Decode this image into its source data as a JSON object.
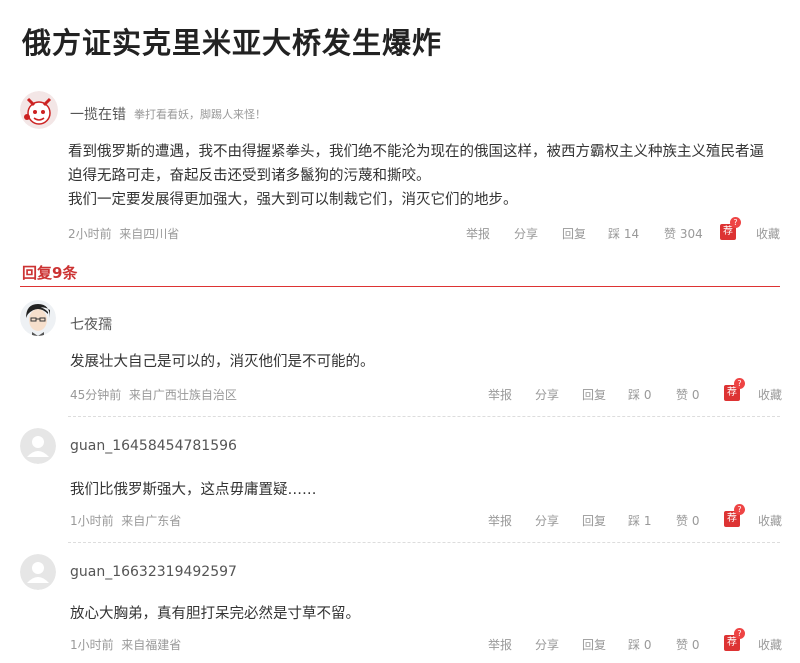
{
  "page": {
    "title": "俄方证实克里米亚大桥发生爆炸"
  },
  "post": {
    "username": "一揽在错",
    "signature": "拳打看看妖，脚踢人来怪！",
    "body_line1": "看到俄罗斯的遭遇，我不由得握紧拳头，我们绝不能沦为现在的俄国这样，被西方霸权主义种族主义殖民者逼",
    "body_line2": "迫得无路可走，奋起反击还受到诸多鬣狗的污蔑和撕咬。",
    "body_line3": "我们一定要发展得更加强大，强大到可以制裁它们，消灭它们的地步。",
    "time": "2小时前",
    "location": "来自四川省",
    "report_label": "举报",
    "share_label": "分享",
    "reply_label": "回复",
    "dislike_label": "踩 14",
    "like_label": "赞 304",
    "recommend_badge": "荐",
    "recommend_dot": "?",
    "favorite_label": "收藏"
  },
  "replies_header": "回复9条",
  "replies": [
    {
      "username": "七夜孺",
      "body": "发展壮大自己是可以的，消灭他们是不可能的。",
      "time": "45分钟前",
      "location": "来自广西壮族自治区",
      "report_label": "举报",
      "share_label": "分享",
      "reply_label": "回复",
      "dislike_label": "踩 0",
      "like_label": "赞 0",
      "recommend_badge": "荐",
      "recommend_dot": "?",
      "favorite_label": "收藏"
    },
    {
      "username": "guan_16458454781596",
      "body": "我们比俄罗斯强大，这点毋庸置疑……",
      "time": "1小时前",
      "location": "来自广东省",
      "report_label": "举报",
      "share_label": "分享",
      "reply_label": "回复",
      "dislike_label": "踩 1",
      "like_label": "赞 0",
      "recommend_badge": "荐",
      "recommend_dot": "?",
      "favorite_label": "收藏"
    },
    {
      "username": "guan_16632319492597",
      "body": "放心大胸弟，真有胆打呆完必然是寸草不留。",
      "time": "1小时前",
      "location": "来自福建省",
      "report_label": "举报",
      "share_label": "分享",
      "reply_label": "回复",
      "dislike_label": "踩 0",
      "like_label": "赞 0",
      "recommend_badge": "荐",
      "recommend_dot": "?",
      "favorite_label": "收藏"
    }
  ],
  "colors": {
    "accent": "#cc3333",
    "meta": "#999999"
  },
  "icons": {
    "main_avatar": "cartoon-avatar-icon",
    "reply_avatar_1": "anime-avatar-icon",
    "default_avatar": "default-user-avatar-icon"
  }
}
